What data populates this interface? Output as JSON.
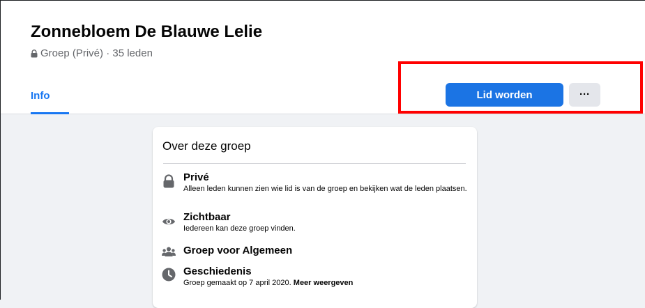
{
  "group": {
    "name": "Zonnebloem De Blauwe Lelie",
    "meta": "Groep (Privé) · 35 leden"
  },
  "tabs": [
    {
      "label": "Info",
      "active": true
    }
  ],
  "actions": {
    "join_label": "Lid worden",
    "more_label": "···"
  },
  "about": {
    "title": "Over deze groep",
    "items": [
      {
        "icon": "lock-icon",
        "heading": "Privé",
        "description": "Alleen leden kunnen zien wie lid is van de groep en bekijken wat de leden plaatsen."
      },
      {
        "icon": "eye-icon",
        "heading": "Zichtbaar",
        "description": "Iedereen kan deze groep vinden."
      },
      {
        "icon": "people-icon",
        "heading": "Groep voor Algemeen",
        "description": ""
      },
      {
        "icon": "clock-icon",
        "heading": "Geschiedenis",
        "description": "Groep gemaakt op 7 april 2020.",
        "link": "Meer weergeven"
      }
    ]
  },
  "colors": {
    "accent": "#1877f2",
    "button_primary": "#1b74e4",
    "button_secondary": "#e4e6eb",
    "background": "#f0f2f5",
    "highlight_box": "#ff0000",
    "icon_gray": "#65676b"
  }
}
